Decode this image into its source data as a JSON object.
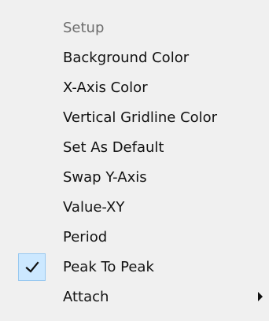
{
  "menu": {
    "items": [
      {
        "label": "Setup",
        "enabled": false,
        "checked": false,
        "has_submenu": false
      },
      {
        "label": "Background Color",
        "enabled": true,
        "checked": false,
        "has_submenu": false
      },
      {
        "label": "X-Axis Color",
        "enabled": true,
        "checked": false,
        "has_submenu": false
      },
      {
        "label": "Vertical Gridline Color",
        "enabled": true,
        "checked": false,
        "has_submenu": false
      },
      {
        "label": "Set As Default",
        "enabled": true,
        "checked": false,
        "has_submenu": false
      },
      {
        "label": "Swap Y-Axis",
        "enabled": true,
        "checked": false,
        "has_submenu": false
      },
      {
        "label": "Value-XY",
        "enabled": true,
        "checked": false,
        "has_submenu": false
      },
      {
        "label": "Period",
        "enabled": true,
        "checked": false,
        "has_submenu": false
      },
      {
        "label": "Peak To Peak",
        "enabled": true,
        "checked": true,
        "has_submenu": false
      },
      {
        "label": "Attach",
        "enabled": true,
        "checked": false,
        "has_submenu": true
      }
    ],
    "icons": {
      "check": "checkmark-icon",
      "submenu": "submenu-arrow-icon"
    },
    "colors": {
      "background": "#f0f0f0",
      "text": "#111111",
      "disabled_text": "#6d6d6d",
      "check_highlight": "#cce8ff"
    }
  }
}
